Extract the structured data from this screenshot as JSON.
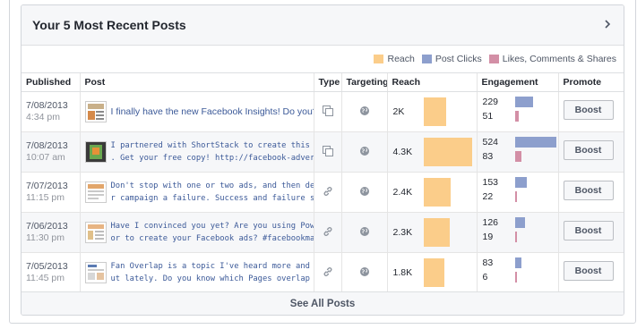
{
  "card": {
    "title": "Your 5 Most Recent Posts",
    "see_all": "See All Posts"
  },
  "legend": [
    {
      "label": "Reach",
      "color": "#fbcd8a"
    },
    {
      "label": "Post Clicks",
      "color": "#8d9fcd"
    },
    {
      "label": "Likes, Comments & Shares",
      "color": "#d38fa6"
    }
  ],
  "columns": {
    "published": "Published",
    "post": "Post",
    "type": "Type",
    "targeting": "Targeting",
    "reach": "Reach",
    "engagement": "Engagement",
    "promote": "Promote"
  },
  "posts": [
    {
      "date": "7/08/2013",
      "time": "4:34 pm",
      "line1": "I finally have the new Facebook Insights! Do you??",
      "line2": "",
      "type_icon": "status-icon",
      "targeting_icon": "globe-icon",
      "reach_label": "2K",
      "reach": 2000,
      "clicks": "229",
      "likes": "51",
      "boost": "Boost"
    },
    {
      "date": "7/08/2013",
      "time": "10:07 am",
      "line1": "I partnered with ShortStack to create this new eBook",
      "line2": ". Get your free copy! http://facebook-advertising-ebo",
      "type_icon": "status-icon",
      "targeting_icon": "globe-icon",
      "reach_label": "4.3K",
      "reach": 4300,
      "clicks": "524",
      "likes": "83",
      "boost": "Boost"
    },
    {
      "date": "7/07/2013",
      "time": "11:15 pm",
      "line1": "Don't stop with one or two ads, and then declare you",
      "line2": "r campaign a failure. Success and failure start with y",
      "type_icon": "link-icon",
      "targeting_icon": "globe-icon",
      "reach_label": "2.4K",
      "reach": 2400,
      "clicks": "153",
      "likes": "22",
      "boost": "Boost"
    },
    {
      "date": "7/06/2013",
      "time": "11:30 pm",
      "line1": "Have I convinced you yet? Are you using Power Edit",
      "line2": "or to create your Facebook ads? #facebookmarketin",
      "type_icon": "link-icon",
      "targeting_icon": "globe-icon",
      "reach_label": "2.3K",
      "reach": 2300,
      "clicks": "126",
      "likes": "19",
      "boost": "Boost"
    },
    {
      "date": "7/05/2013",
      "time": "11:45 pm",
      "line1": "Fan Overlap is a topic I've heard more and more abo",
      "line2": "ut lately. Do you know which Pages overlap with you",
      "type_icon": "link-icon",
      "targeting_icon": "globe-icon",
      "reach_label": "1.8K",
      "reach": 1800,
      "clicks": "83",
      "likes": "6",
      "boost": "Boost"
    }
  ]
}
